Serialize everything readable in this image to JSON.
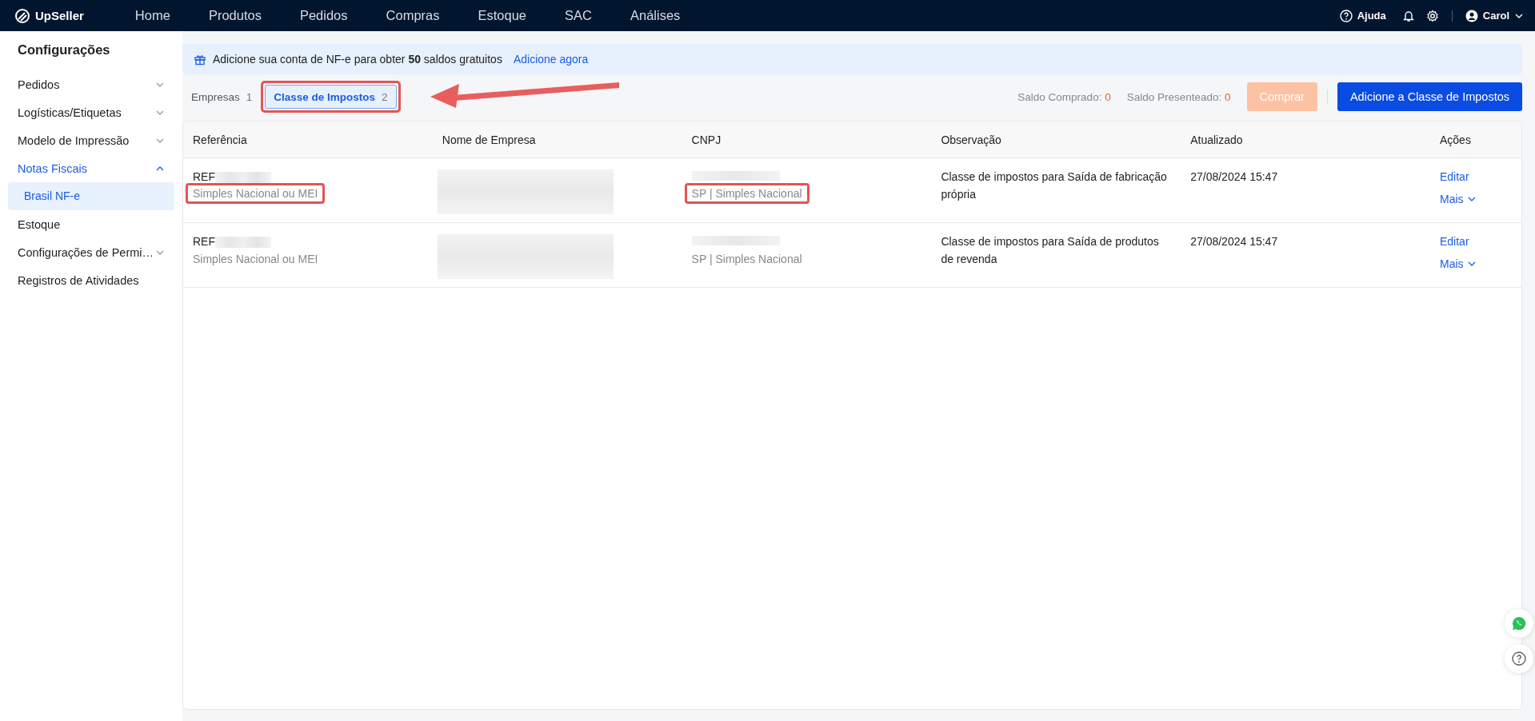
{
  "topbar": {
    "logo": "UpSeller",
    "menu": [
      {
        "label": "Home"
      },
      {
        "label": "Produtos"
      },
      {
        "label": "Pedidos"
      },
      {
        "label": "Compras"
      },
      {
        "label": "Estoque"
      },
      {
        "label": "SAC"
      },
      {
        "label": "Análises"
      }
    ],
    "help": "Ajuda",
    "user": "Carol"
  },
  "sidebar": {
    "title": "Configurações",
    "items": [
      {
        "label": "Pedidos",
        "kind": "group",
        "expanded": false
      },
      {
        "label": "Logísticas/Etiquetas",
        "kind": "group",
        "expanded": false
      },
      {
        "label": "Modelo de Impressão",
        "kind": "group",
        "expanded": false
      },
      {
        "label": "Notas Fiscais",
        "kind": "group",
        "expanded": true,
        "children": [
          {
            "label": "Brasil NF-e",
            "selected": true
          }
        ]
      },
      {
        "label": "Estoque",
        "kind": "link"
      },
      {
        "label": "Configurações de Permi…",
        "kind": "group",
        "expanded": false
      },
      {
        "label": "Registros de Atividades",
        "kind": "link"
      }
    ]
  },
  "banner": {
    "text": "Adicione sua conta de NF-e para obter **50** saldos gratuitos",
    "link": "Adicione agora"
  },
  "tabs": [
    {
      "label": "Empresas",
      "count": "1",
      "selected": false,
      "highlighted": false,
      "pointed": false
    },
    {
      "label": "Classe de Impostos",
      "count": "2",
      "selected": true,
      "highlighted": true,
      "pointed": true
    }
  ],
  "balances": [
    {
      "label": "Saldo Comprado:",
      "value": "0"
    },
    {
      "label": "Saldo Presenteado:",
      "value": "0"
    }
  ],
  "buy_button": {
    "label": "Comprar",
    "disabled": true
  },
  "add_button": {
    "label": "Adicione a Classe de Impostos"
  },
  "table": {
    "columns": [
      "Referência",
      "Nome de Empresa",
      "CNPJ",
      "Observação",
      "Atualizado",
      "Ações"
    ],
    "rows": [
      {
        "reference": "REF",
        "regime": "Simples Nacional ou MEI",
        "regime_highlighted": true,
        "cnpj_detail": "SP | Simples Nacional",
        "cnpj_highlighted": true,
        "redacted": true,
        "observation": "Classe de impostos para Saída de fabricação própria",
        "updated": "27/08/2024 15:47",
        "actions": [
          "Editar",
          "Mais"
        ]
      },
      {
        "reference": "REF",
        "regime": "Simples Nacional ou MEI",
        "regime_highlighted": false,
        "cnpj_detail": "SP | Simples Nacional",
        "cnpj_highlighted": false,
        "redacted": true,
        "observation": "Classe de impostos para Saída de produtos de revenda",
        "updated": "27/08/2024 15:47",
        "actions": [
          "Editar",
          "Mais"
        ]
      }
    ]
  }
}
